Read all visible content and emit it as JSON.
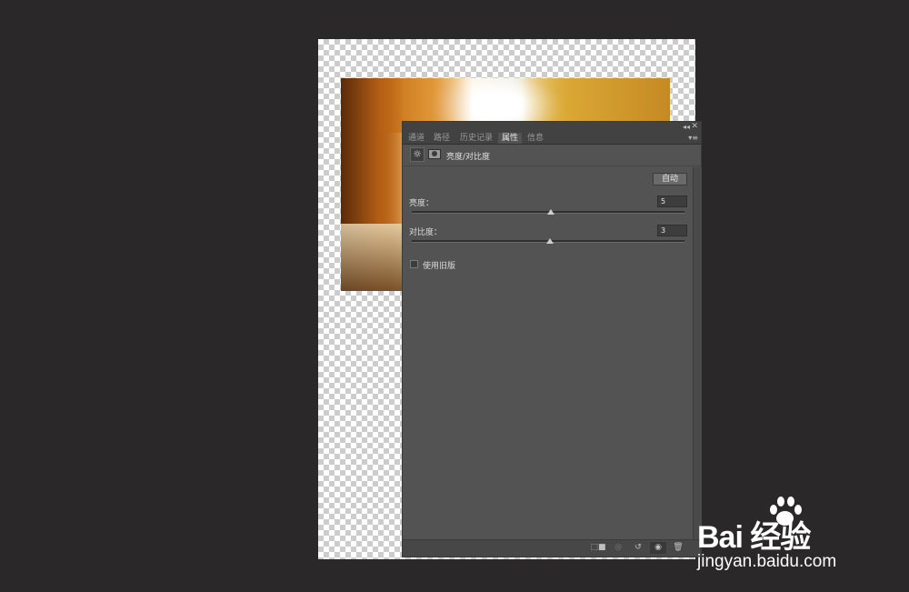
{
  "panel": {
    "tabs": [
      {
        "label": "通道",
        "active": false
      },
      {
        "label": "路径",
        "active": false
      },
      {
        "label": "历史记录",
        "active": false
      },
      {
        "label": "属性",
        "active": true
      },
      {
        "label": "信息",
        "active": false
      }
    ],
    "header_title": "亮度/对比度",
    "auto_label": "自动",
    "brightness": {
      "label": "亮度：",
      "value": "5",
      "slider_fraction": 0.51
    },
    "contrast": {
      "label": "对比度：",
      "value": "3",
      "slider_fraction": 0.505
    },
    "legacy_label": "使用旧版",
    "legacy_checked": false,
    "bottom_icons": [
      "clip-to-layer-icon",
      "view-previous-icon",
      "reset-icon",
      "visibility-eye-icon",
      "trash-icon"
    ]
  },
  "watermark": {
    "logo": "Bai 经验",
    "tagline": "jingyan.baidu.com"
  },
  "colors": {
    "panel_bg": "#535353",
    "app_bg": "#2a2829",
    "accent_thumb": "#cfcfcf"
  }
}
